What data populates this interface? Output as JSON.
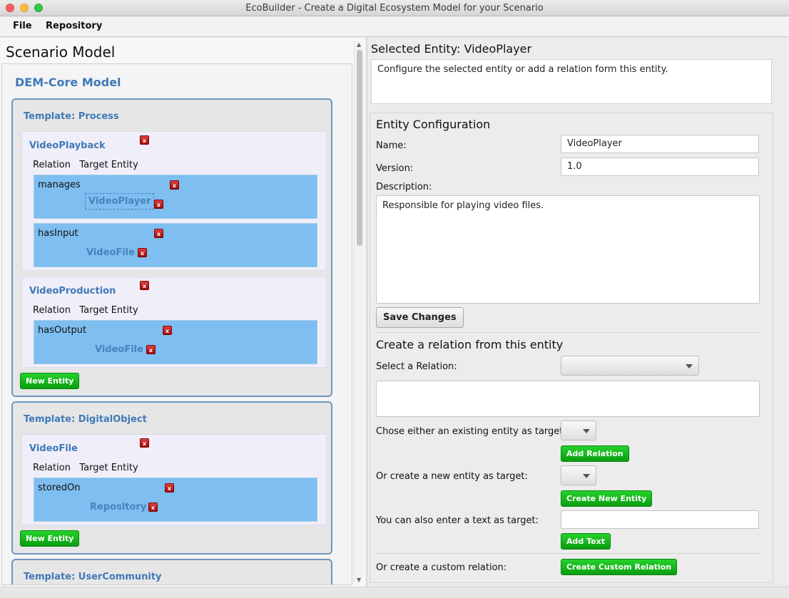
{
  "window": {
    "title": "EcoBuilder - Create a Digital Ecosystem Model for your Scenario"
  },
  "menu": {
    "file": "File",
    "repository": "Repository"
  },
  "left": {
    "scenario_title": "Scenario Model",
    "core_title": "DEM-Core Model",
    "rel_header_relation": "Relation",
    "rel_header_target": "Target Entity",
    "new_entity_label": "New Entity",
    "x_label": "x",
    "templates": [
      {
        "title": "Template: Process",
        "entities": [
          {
            "name": "VideoPlayback",
            "relations": [
              {
                "name": "manages",
                "target": "VideoPlayer",
                "selected": true
              },
              {
                "name": "hasInput",
                "target": "VideoFile"
              }
            ]
          },
          {
            "name": "VideoProduction",
            "relations": [
              {
                "name": "hasOutput",
                "target": "VideoFile"
              }
            ]
          }
        ]
      },
      {
        "title": "Template: DigitalObject",
        "entities": [
          {
            "name": "VideoFile",
            "relations": [
              {
                "name": "storedOn",
                "target": "Repository"
              }
            ]
          }
        ]
      },
      {
        "title": "Template: UserCommunity"
      }
    ]
  },
  "right": {
    "selected_title": "Selected Entity: VideoPlayer",
    "info_text": "Configure the selected entity or add a relation form this entity.",
    "config": {
      "title": "Entity Configuration",
      "name_label": "Name:",
      "name_value": "VideoPlayer",
      "version_label": "Version:",
      "version_value": "1.0",
      "description_label": "Description:",
      "description_value": "Responsible for playing video files.",
      "save_button": "Save Changes"
    },
    "relation": {
      "title": "Create a relation from this entity",
      "select_label": "Select a Relation:",
      "existing_label": "Chose either an existing entity as target:",
      "add_relation_button": "Add Relation",
      "new_label": "Or create a new entity as target:",
      "create_new_entity_button": "Create New Entity",
      "text_label": "You can also enter a text as target:",
      "text_value": "",
      "add_text_button": "Add Text",
      "custom_label": "Or create a custom relation:",
      "create_custom_button": "Create Custom Relation"
    }
  }
}
